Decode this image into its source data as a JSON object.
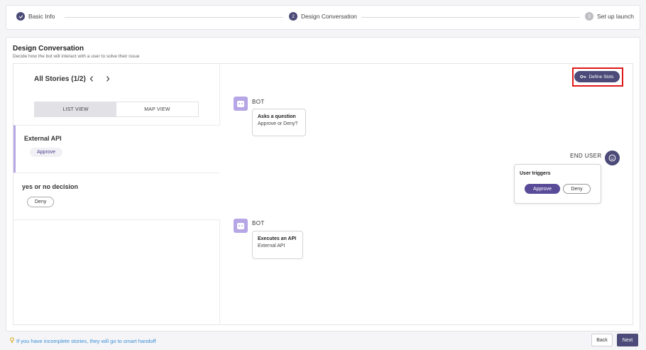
{
  "stepper": {
    "steps": [
      {
        "number": "",
        "label": "Basic Info",
        "state": "completed"
      },
      {
        "number": "2",
        "label": "Design Conversation",
        "state": "active"
      },
      {
        "number": "3",
        "label": "Set up launch",
        "state": "upcoming"
      }
    ],
    "completed_icon": "check-icon"
  },
  "header": {
    "title": "Design Conversation",
    "subtitle": "Decide how the bot will interact with a user to solve their issue"
  },
  "stories_panel": {
    "title": "All Stories (1/2)",
    "prev_icon": "chevron-left-icon",
    "next_icon": "chevron-right-icon",
    "views": {
      "list": "LIST VIEW",
      "map": "MAP VIEW",
      "active": "list"
    },
    "stories": [
      {
        "name": "External API",
        "chip": "Approve"
      },
      {
        "name": "yes or no decision",
        "chip": "Deny"
      }
    ]
  },
  "canvas": {
    "define_slots": {
      "label": "Define Slots",
      "icon": "key-icon"
    },
    "messages": [
      {
        "speaker": "BOT",
        "title": "Asks a question",
        "text": "Approve or Deny?"
      },
      {
        "speaker": "END USER",
        "title": "User triggers",
        "options": [
          "Approve",
          "Deny"
        ]
      },
      {
        "speaker": "BOT",
        "title": "Executes an API",
        "text": "External API"
      }
    ]
  },
  "footer": {
    "hint": "If you have incomplete stories, they will go to smart handoff",
    "hint_icon": "lightbulb-icon",
    "back": "Back",
    "next": "Next"
  },
  "colors": {
    "primary": "#4b4a78",
    "bot_avatar": "#b6a6e6",
    "highlight": "#e01818",
    "link": "#3a8fd6"
  }
}
